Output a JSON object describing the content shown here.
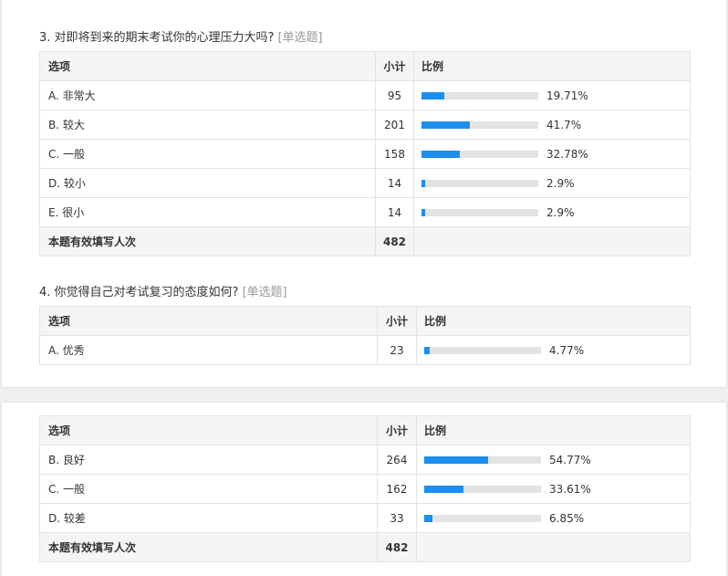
{
  "colors": {
    "bar_fill": "#1b8ef0",
    "bar_track": "#e3e3e3",
    "header_bg": "#f5f5f5"
  },
  "headers": {
    "option": "选项",
    "count": "小计",
    "ratio": "比例"
  },
  "total_label": "本题有效填写人次",
  "q3": {
    "title": "3. 对即将到来的期末考试你的心理压力大吗?",
    "type": "[单选题]",
    "rows": [
      {
        "option": "A. 非常大",
        "count": "95",
        "percent": "19.71%",
        "ratio": 0.1971
      },
      {
        "option": "B. 较大",
        "count": "201",
        "percent": "41.7%",
        "ratio": 0.417
      },
      {
        "option": "C. 一般",
        "count": "158",
        "percent": "32.78%",
        "ratio": 0.3278
      },
      {
        "option": "D. 较小",
        "count": "14",
        "percent": "2.9%",
        "ratio": 0.029
      },
      {
        "option": "E. 很小",
        "count": "14",
        "percent": "2.9%",
        "ratio": 0.029
      }
    ],
    "total": "482"
  },
  "q4": {
    "title": "4. 你觉得自己对考试复习的态度如何?",
    "type": "[单选题]",
    "rows": [
      {
        "option": "A. 优秀",
        "count": "23",
        "percent": "4.77%",
        "ratio": 0.0477
      },
      {
        "option": "B. 良好",
        "count": "264",
        "percent": "54.77%",
        "ratio": 0.5477
      },
      {
        "option": "C. 一般",
        "count": "162",
        "percent": "33.61%",
        "ratio": 0.3361
      },
      {
        "option": "D. 较差",
        "count": "33",
        "percent": "6.85%",
        "ratio": 0.0685
      }
    ],
    "total": "482"
  }
}
